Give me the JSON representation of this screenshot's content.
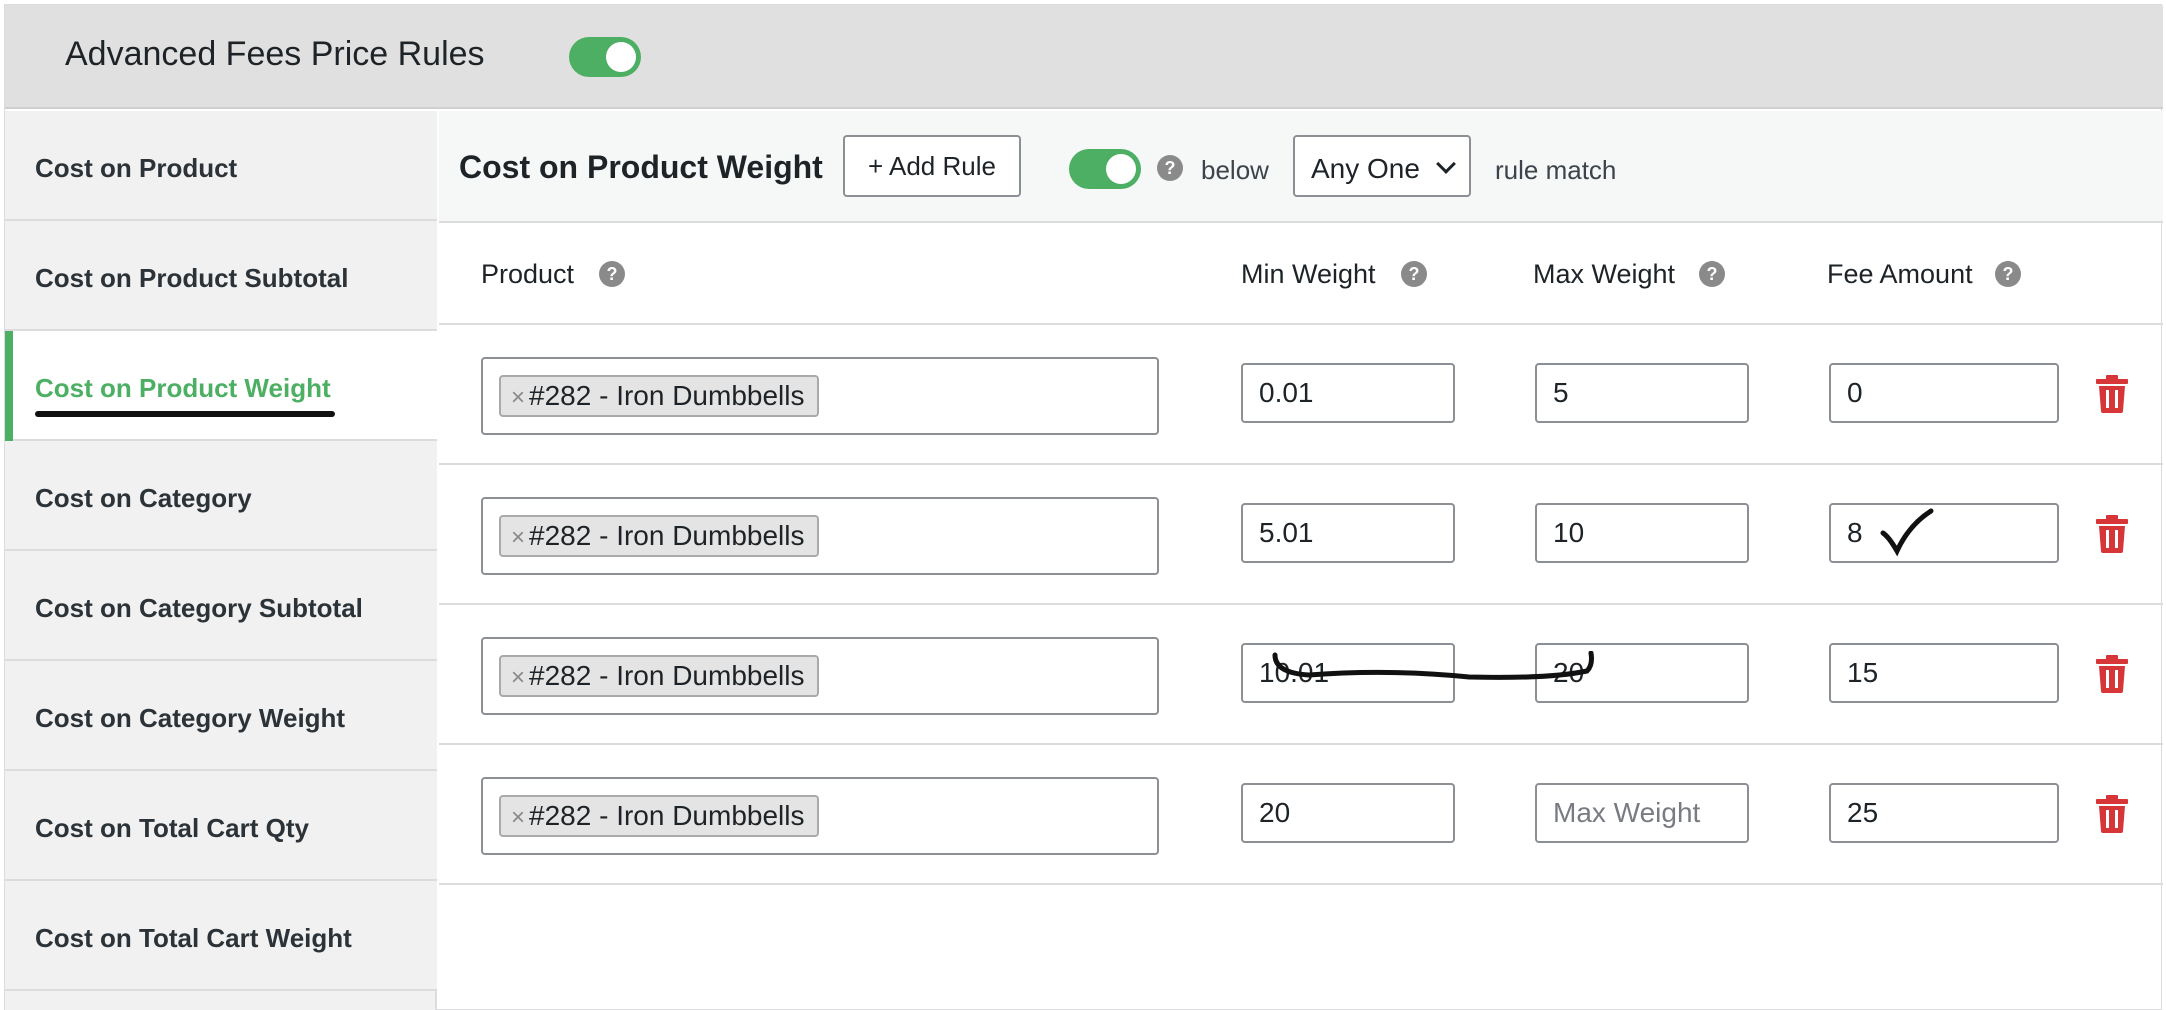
{
  "header": {
    "title": "Advanced Fees Price Rules",
    "enabled": true
  },
  "sidebar": {
    "items": [
      {
        "label": "Cost on Product",
        "active": false
      },
      {
        "label": "Cost on Product Subtotal",
        "active": false
      },
      {
        "label": "Cost on Product Weight",
        "active": true
      },
      {
        "label": "Cost on Category",
        "active": false
      },
      {
        "label": "Cost on Category Subtotal",
        "active": false
      },
      {
        "label": "Cost on Category Weight",
        "active": false
      },
      {
        "label": "Cost on Total Cart Qty",
        "active": false
      },
      {
        "label": "Cost on Total Cart Weight",
        "active": false
      }
    ]
  },
  "section": {
    "title": "Cost on Product Weight",
    "add_rule_label": "+ Add Rule",
    "enabled": true,
    "help_icon": "?",
    "below_label": "below",
    "match_select_value": "Any One",
    "rule_match_label": "rule match"
  },
  "table": {
    "columns": [
      "Product",
      "Min Weight",
      "Max Weight",
      "Fee Amount"
    ],
    "help_icon": "?",
    "rows": [
      {
        "product_remove": "×",
        "product": "#282 - Iron Dumbbells",
        "min_weight": "0.01",
        "max_weight": "5",
        "fee": "0"
      },
      {
        "product_remove": "×",
        "product": "#282 - Iron Dumbbells",
        "min_weight": "5.01",
        "max_weight": "10",
        "fee": "8"
      },
      {
        "product_remove": "×",
        "product": "#282 - Iron Dumbbells",
        "min_weight": "10.01",
        "max_weight": "20",
        "fee": "15"
      },
      {
        "product_remove": "×",
        "product": "#282 - Iron Dumbbells",
        "min_weight": "20",
        "max_weight": "",
        "fee": "25"
      }
    ],
    "max_weight_placeholder": "Max Weight"
  },
  "colors": {
    "accent_green": "#4caf63",
    "delete_red": "#d63638"
  },
  "icons": {
    "delete": "trash-icon",
    "help": "help-icon",
    "dropdown": "chevron-down-icon",
    "remove_tag": "close-icon"
  }
}
